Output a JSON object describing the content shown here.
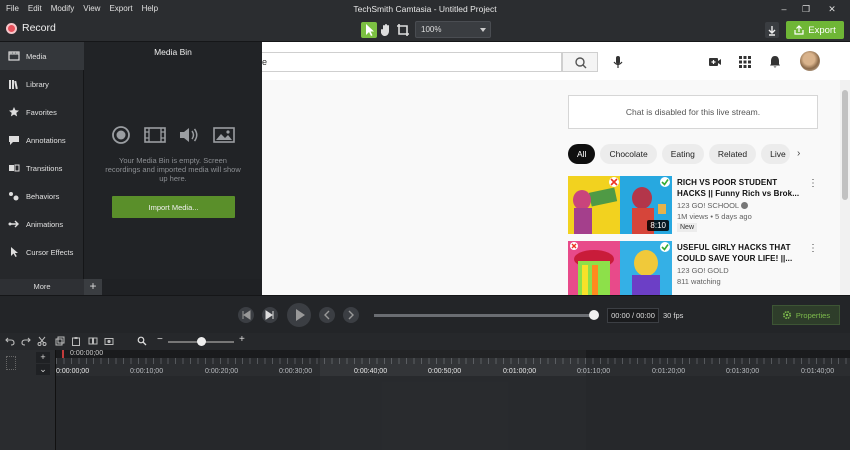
{
  "titlebar": {
    "menu": [
      "File",
      "Edit",
      "Modify",
      "View",
      "Export",
      "Help"
    ],
    "title": "TechSmith Camtasia - Untitled Project",
    "minimize": "–",
    "maximize": "❐",
    "close": "✕"
  },
  "toolbar": {
    "record_label": "Record",
    "zoom_value": "100%",
    "export_label": "Export",
    "accent": "#6fb636"
  },
  "nav": {
    "items": [
      {
        "label": "Media",
        "icon": "media-icon"
      },
      {
        "label": "Library",
        "icon": "library-icon"
      },
      {
        "label": "Favorites",
        "icon": "star-icon"
      },
      {
        "label": "Annotations",
        "icon": "annotation-icon"
      },
      {
        "label": "Transitions",
        "icon": "transitions-icon"
      },
      {
        "label": "Behaviors",
        "icon": "behaviors-icon"
      },
      {
        "label": "Animations",
        "icon": "animations-icon"
      },
      {
        "label": "Cursor Effects",
        "icon": "cursor-icon"
      }
    ],
    "more_label": "More",
    "add_label": "+"
  },
  "mediabin": {
    "title": "Media Bin",
    "empty_text": "Your Media Bin is empty. Screen recordings and imported media will show up here.",
    "import_label": "Import Media..."
  },
  "youtube": {
    "search_value": "e",
    "chat_disabled": "Chat is disabled for this live stream.",
    "chips": [
      "All",
      "Chocolate",
      "Eating",
      "Related",
      "Live"
    ],
    "videos": [
      {
        "title": "RICH VS POOR STUDENT HACKS || Funny Rich vs Brok...",
        "channel": "123 GO! SCHOOL",
        "meta": "1M views • 5 days ago",
        "badge": "New",
        "duration": "8:10"
      },
      {
        "title": "USEFUL GIRLY HACKS THAT COULD SAVE YOUR LIFE! ||...",
        "channel": "123 GO! GOLD",
        "meta": "811 watching",
        "badge": "",
        "duration": ""
      }
    ]
  },
  "playback": {
    "timecode": "00:00 / 00:00",
    "fps": "30 fps",
    "properties_label": "Properties"
  },
  "timeline": {
    "playhead_time": "0:00:00;00",
    "ruler": [
      "0:00:00;00",
      "0:00:10;00",
      "0:00:20;00",
      "0:00:30;00",
      "0:00:40;00",
      "0:00:50;00",
      "0:01:00;00",
      "0:01:10;00",
      "0:01:20;00",
      "0:01:30;00",
      "0:01:40;00"
    ]
  }
}
